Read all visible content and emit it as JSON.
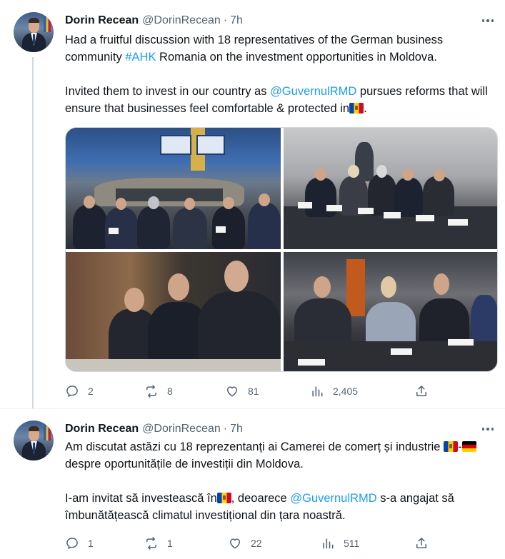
{
  "tweets": [
    {
      "author_name": "Dorin Recean",
      "handle": "@DorinRecean",
      "separator": "·",
      "time": "7h",
      "line1": "Had a fruitful discussion with 18 representatives of the German business community ",
      "hashtag": "#AHK",
      "line1_end": " Romania on the investment opportunities in Moldova.",
      "para2_start": "Invited them to invest in our country as ",
      "mention": "@GuvernulRMD",
      "para2_end": " pursues reforms that will ensure that businesses feel comfortable & protected in",
      "para2_tail": ".",
      "flag_emoji": "Moldova flag",
      "images": [
        "meeting-room-wide",
        "panel-participants",
        "officials-closeup",
        "business-guests"
      ],
      "replies": "2",
      "reposts": "8",
      "likes": "81",
      "views": "2,405"
    },
    {
      "author_name": "Dorin Recean",
      "handle": "@DorinRecean",
      "separator": "·",
      "time": "7h",
      "line1": "Am discutat astăzi cu 18 reprezentanți ai Camerei de comerț și industrie ",
      "flag_sep": "-",
      "line1_end": "despre oportunitățile de investiții din Moldova.",
      "para2_start": "I-am invitat să investească în",
      "para2_mid": ", deoarece ",
      "mention": "@GuvernulRMD",
      "para2_end": " s-a angajat să îmbunătățească climatul investițional din țara noastră.",
      "replies": "1",
      "reposts": "1",
      "likes": "22",
      "views": "511"
    }
  ],
  "colors": {
    "text": "#0f1419",
    "secondary": "#536471",
    "link": "#1d9bf0",
    "thread_line": "#cfd9de",
    "divider": "#eff3f4"
  },
  "icons": [
    "more-icon",
    "reply-icon",
    "repost-icon",
    "like-icon",
    "views-icon",
    "share-icon"
  ]
}
